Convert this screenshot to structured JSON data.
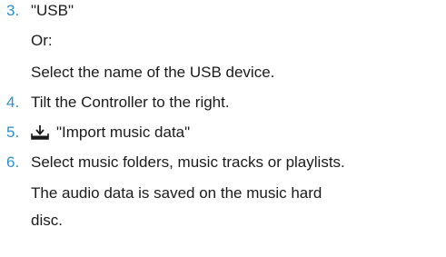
{
  "steps": [
    {
      "number": "3.",
      "text": "\"USB\""
    },
    {
      "number": "4.",
      "text": "Tilt the Controller to the right."
    },
    {
      "number": "5.",
      "icon": "import-icon",
      "text": "\"Import music data\""
    },
    {
      "number": "6.",
      "text": "Select music folders, music tracks or playlists."
    }
  ],
  "notes": {
    "or_label": "Or:",
    "select_usb": "Select the name of the USB device.",
    "saved_line1": "The audio data is saved on the music hard",
    "saved_line2": "disc."
  },
  "colors": {
    "step_number": "#2b8fc9",
    "text": "#1a1a1a"
  }
}
